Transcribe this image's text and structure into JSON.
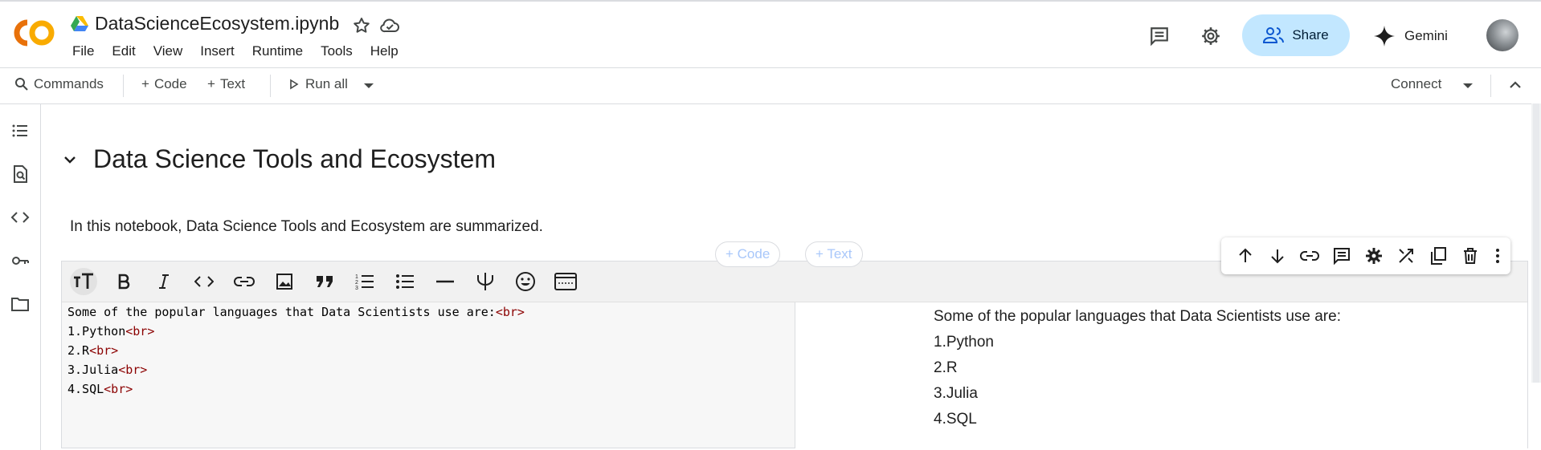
{
  "app": {
    "file_title": "DataScienceEcosystem.ipynb",
    "menu": [
      "File",
      "Edit",
      "View",
      "Insert",
      "Runtime",
      "Tools",
      "Help"
    ],
    "share_label": "Share",
    "gemini_label": "Gemini"
  },
  "toolbar": {
    "commands_label": "Commands",
    "code_label": "Code",
    "text_label": "Text",
    "run_all_label": "Run all",
    "connect_label": "Connect"
  },
  "notebook": {
    "section_title": "Data Science Tools and Ecosystem",
    "intro_text": "In this notebook, Data Science Tools and Ecosystem are summarized.",
    "add_code_label": "+ Code",
    "add_text_label": "+ Text",
    "cell": {
      "source_lines": [
        {
          "text": "Some of the popular languages that Data Scientists use are:",
          "tag": "<br>"
        },
        {
          "text": "1.Python",
          "tag": "<br>"
        },
        {
          "text": "2.R",
          "tag": "<br>"
        },
        {
          "text": "3.Julia",
          "tag": "<br>"
        },
        {
          "text": "4.SQL",
          "tag": "<br>"
        }
      ],
      "preview_lines": [
        "Some of the popular languages that Data Scientists use are:",
        "1.Python",
        "2.R",
        "3.Julia",
        "4.SQL"
      ]
    }
  },
  "icons": {
    "header": [
      "colab-logo",
      "drive-icon",
      "star-icon",
      "cloud-icon",
      "comment-icon",
      "settings-icon",
      "people-icon",
      "gemini-sparkle-icon",
      "avatar"
    ],
    "sidebar": [
      "toc-icon",
      "find-icon",
      "code-snippets-icon",
      "secrets-key-icon",
      "folder-icon"
    ],
    "format_toolbar": [
      "text-size-icon",
      "bold-icon",
      "italic-icon",
      "code-icon",
      "link-icon",
      "image-icon",
      "quote-icon",
      "numbered-list-icon",
      "bulleted-list-icon",
      "horizontal-rule-icon",
      "latex-psi-icon",
      "emoji-icon",
      "layout-icon"
    ],
    "cell_tools": [
      "arrow-up-icon",
      "arrow-down-icon",
      "link-icon",
      "comment-icon",
      "settings-icon",
      "mirror-cell-icon",
      "copy-cell-icon",
      "delete-icon",
      "more-vert-icon"
    ]
  },
  "colors": {
    "accent_share": "#c2e7ff",
    "colab_orange": "#f9ab00",
    "colab_dark_orange": "#e8710a",
    "html_tag": "#8b0000",
    "add_button_text": "#a8c7fa"
  }
}
